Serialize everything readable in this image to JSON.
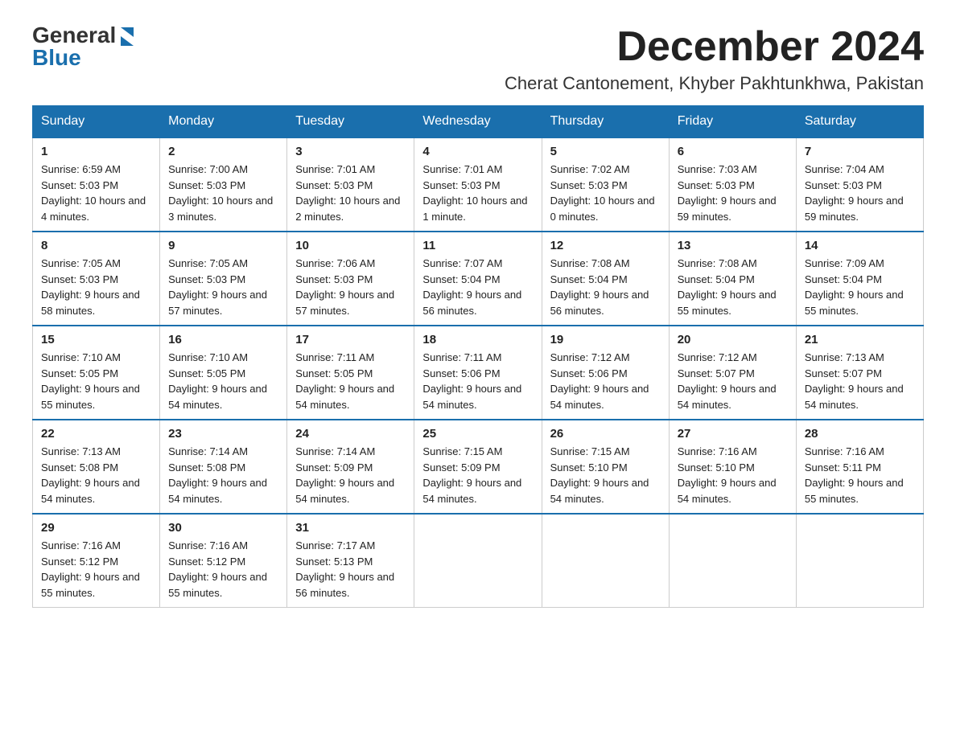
{
  "logo": {
    "general": "General",
    "blue": "Blue"
  },
  "header": {
    "month": "December 2024",
    "location": "Cherat Cantonement, Khyber Pakhtunkhwa, Pakistan"
  },
  "days_of_week": [
    "Sunday",
    "Monday",
    "Tuesday",
    "Wednesday",
    "Thursday",
    "Friday",
    "Saturday"
  ],
  "weeks": [
    [
      {
        "day": "1",
        "sunrise": "6:59 AM",
        "sunset": "5:03 PM",
        "daylight": "10 hours and 4 minutes."
      },
      {
        "day": "2",
        "sunrise": "7:00 AM",
        "sunset": "5:03 PM",
        "daylight": "10 hours and 3 minutes."
      },
      {
        "day": "3",
        "sunrise": "7:01 AM",
        "sunset": "5:03 PM",
        "daylight": "10 hours and 2 minutes."
      },
      {
        "day": "4",
        "sunrise": "7:01 AM",
        "sunset": "5:03 PM",
        "daylight": "10 hours and 1 minute."
      },
      {
        "day": "5",
        "sunrise": "7:02 AM",
        "sunset": "5:03 PM",
        "daylight": "10 hours and 0 minutes."
      },
      {
        "day": "6",
        "sunrise": "7:03 AM",
        "sunset": "5:03 PM",
        "daylight": "9 hours and 59 minutes."
      },
      {
        "day": "7",
        "sunrise": "7:04 AM",
        "sunset": "5:03 PM",
        "daylight": "9 hours and 59 minutes."
      }
    ],
    [
      {
        "day": "8",
        "sunrise": "7:05 AM",
        "sunset": "5:03 PM",
        "daylight": "9 hours and 58 minutes."
      },
      {
        "day": "9",
        "sunrise": "7:05 AM",
        "sunset": "5:03 PM",
        "daylight": "9 hours and 57 minutes."
      },
      {
        "day": "10",
        "sunrise": "7:06 AM",
        "sunset": "5:03 PM",
        "daylight": "9 hours and 57 minutes."
      },
      {
        "day": "11",
        "sunrise": "7:07 AM",
        "sunset": "5:04 PM",
        "daylight": "9 hours and 56 minutes."
      },
      {
        "day": "12",
        "sunrise": "7:08 AM",
        "sunset": "5:04 PM",
        "daylight": "9 hours and 56 minutes."
      },
      {
        "day": "13",
        "sunrise": "7:08 AM",
        "sunset": "5:04 PM",
        "daylight": "9 hours and 55 minutes."
      },
      {
        "day": "14",
        "sunrise": "7:09 AM",
        "sunset": "5:04 PM",
        "daylight": "9 hours and 55 minutes."
      }
    ],
    [
      {
        "day": "15",
        "sunrise": "7:10 AM",
        "sunset": "5:05 PM",
        "daylight": "9 hours and 55 minutes."
      },
      {
        "day": "16",
        "sunrise": "7:10 AM",
        "sunset": "5:05 PM",
        "daylight": "9 hours and 54 minutes."
      },
      {
        "day": "17",
        "sunrise": "7:11 AM",
        "sunset": "5:05 PM",
        "daylight": "9 hours and 54 minutes."
      },
      {
        "day": "18",
        "sunrise": "7:11 AM",
        "sunset": "5:06 PM",
        "daylight": "9 hours and 54 minutes."
      },
      {
        "day": "19",
        "sunrise": "7:12 AM",
        "sunset": "5:06 PM",
        "daylight": "9 hours and 54 minutes."
      },
      {
        "day": "20",
        "sunrise": "7:12 AM",
        "sunset": "5:07 PM",
        "daylight": "9 hours and 54 minutes."
      },
      {
        "day": "21",
        "sunrise": "7:13 AM",
        "sunset": "5:07 PM",
        "daylight": "9 hours and 54 minutes."
      }
    ],
    [
      {
        "day": "22",
        "sunrise": "7:13 AM",
        "sunset": "5:08 PM",
        "daylight": "9 hours and 54 minutes."
      },
      {
        "day": "23",
        "sunrise": "7:14 AM",
        "sunset": "5:08 PM",
        "daylight": "9 hours and 54 minutes."
      },
      {
        "day": "24",
        "sunrise": "7:14 AM",
        "sunset": "5:09 PM",
        "daylight": "9 hours and 54 minutes."
      },
      {
        "day": "25",
        "sunrise": "7:15 AM",
        "sunset": "5:09 PM",
        "daylight": "9 hours and 54 minutes."
      },
      {
        "day": "26",
        "sunrise": "7:15 AM",
        "sunset": "5:10 PM",
        "daylight": "9 hours and 54 minutes."
      },
      {
        "day": "27",
        "sunrise": "7:16 AM",
        "sunset": "5:10 PM",
        "daylight": "9 hours and 54 minutes."
      },
      {
        "day": "28",
        "sunrise": "7:16 AM",
        "sunset": "5:11 PM",
        "daylight": "9 hours and 55 minutes."
      }
    ],
    [
      {
        "day": "29",
        "sunrise": "7:16 AM",
        "sunset": "5:12 PM",
        "daylight": "9 hours and 55 minutes."
      },
      {
        "day": "30",
        "sunrise": "7:16 AM",
        "sunset": "5:12 PM",
        "daylight": "9 hours and 55 minutes."
      },
      {
        "day": "31",
        "sunrise": "7:17 AM",
        "sunset": "5:13 PM",
        "daylight": "9 hours and 56 minutes."
      },
      null,
      null,
      null,
      null
    ]
  ]
}
